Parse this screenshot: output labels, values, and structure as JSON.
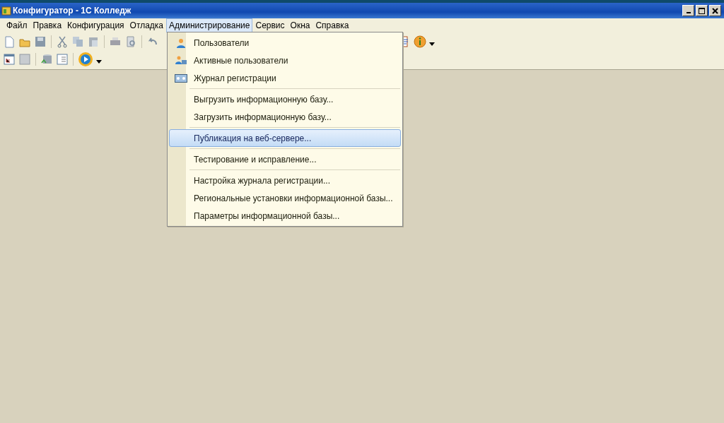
{
  "window": {
    "title": "Конфигуратор - 1С Колледж"
  },
  "menu_bar": [
    {
      "label": "Файл",
      "selected": false
    },
    {
      "label": "Правка",
      "selected": false
    },
    {
      "label": "Конфигурация",
      "selected": false
    },
    {
      "label": "Отладка",
      "selected": false
    },
    {
      "label": "Администрирование",
      "selected": true
    },
    {
      "label": "Сервис",
      "selected": false
    },
    {
      "label": "Окна",
      "selected": false
    },
    {
      "label": "Справка",
      "selected": false
    }
  ],
  "dropdown": {
    "groups": [
      [
        {
          "kind": "users",
          "label": "Пользователи",
          "selected": false
        },
        {
          "kind": "sessions",
          "label": "Активные пользователи",
          "selected": false
        },
        {
          "kind": "log",
          "label": "Журнал регистрации",
          "selected": false
        }
      ],
      [
        {
          "kind": "plain",
          "label": "Выгрузить информационную базу...",
          "selected": false
        },
        {
          "kind": "plain",
          "label": "Загрузить информационную базу...",
          "selected": false
        }
      ],
      [
        {
          "kind": "plain",
          "label": "Публикация на веб-сервере...",
          "selected": true
        }
      ],
      [
        {
          "kind": "plain",
          "label": "Тестирование и исправление...",
          "selected": false
        }
      ],
      [
        {
          "kind": "plain",
          "label": "Настройка журнала регистрации...",
          "selected": false
        },
        {
          "kind": "plain",
          "label": "Региональные установки информационной базы...",
          "selected": false
        },
        {
          "kind": "plain",
          "label": "Параметры информационной базы...",
          "selected": false
        }
      ]
    ]
  }
}
